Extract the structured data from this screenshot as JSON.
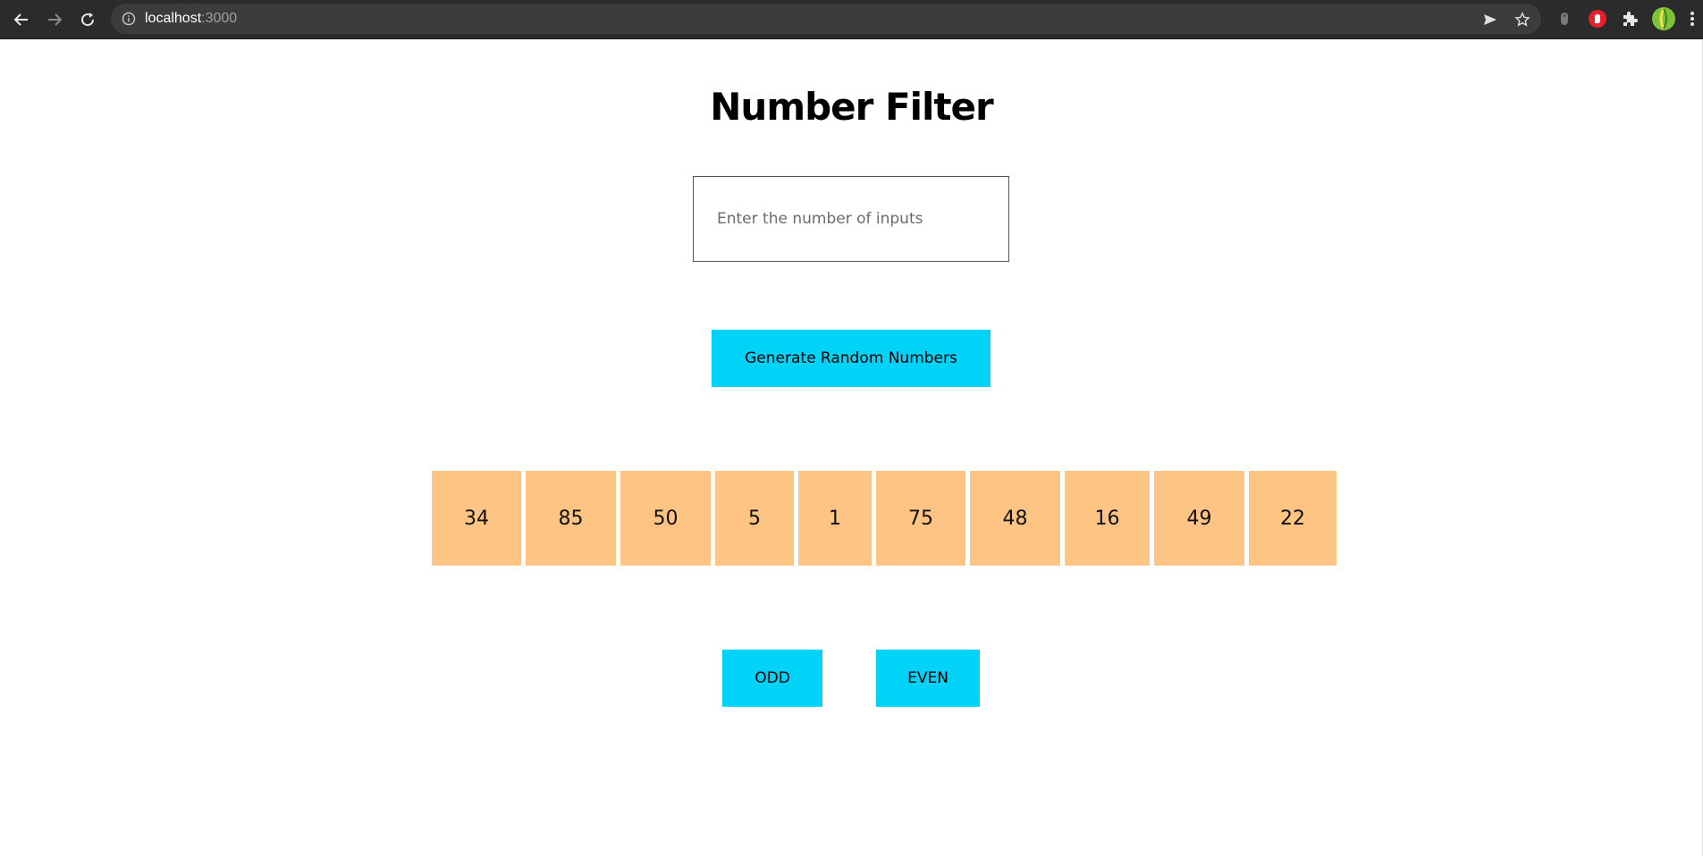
{
  "browser": {
    "url_host": "localhost",
    "url_port": ":3000",
    "icons": [
      "back-arrow-icon",
      "forward-arrow-icon",
      "reload-icon",
      "info-icon",
      "send-icon",
      "star-icon",
      "extension-mouse-icon",
      "adblock-icon",
      "puzzle-icon",
      "avatar",
      "kebab-menu-icon"
    ]
  },
  "page": {
    "title": "Number Filter",
    "input": {
      "placeholder": "Enter the number of inputs",
      "value": ""
    },
    "generate_label": "Generate Random Numbers",
    "numbers": [
      "34",
      "85",
      "50",
      "5",
      "1",
      "75",
      "48",
      "16",
      "49",
      "22"
    ],
    "odd_label": "ODD",
    "even_label": "EVEN"
  },
  "colors": {
    "accent": "#00d3f7",
    "number_tile": "#fdc484",
    "chrome": "#2b2b2b"
  }
}
